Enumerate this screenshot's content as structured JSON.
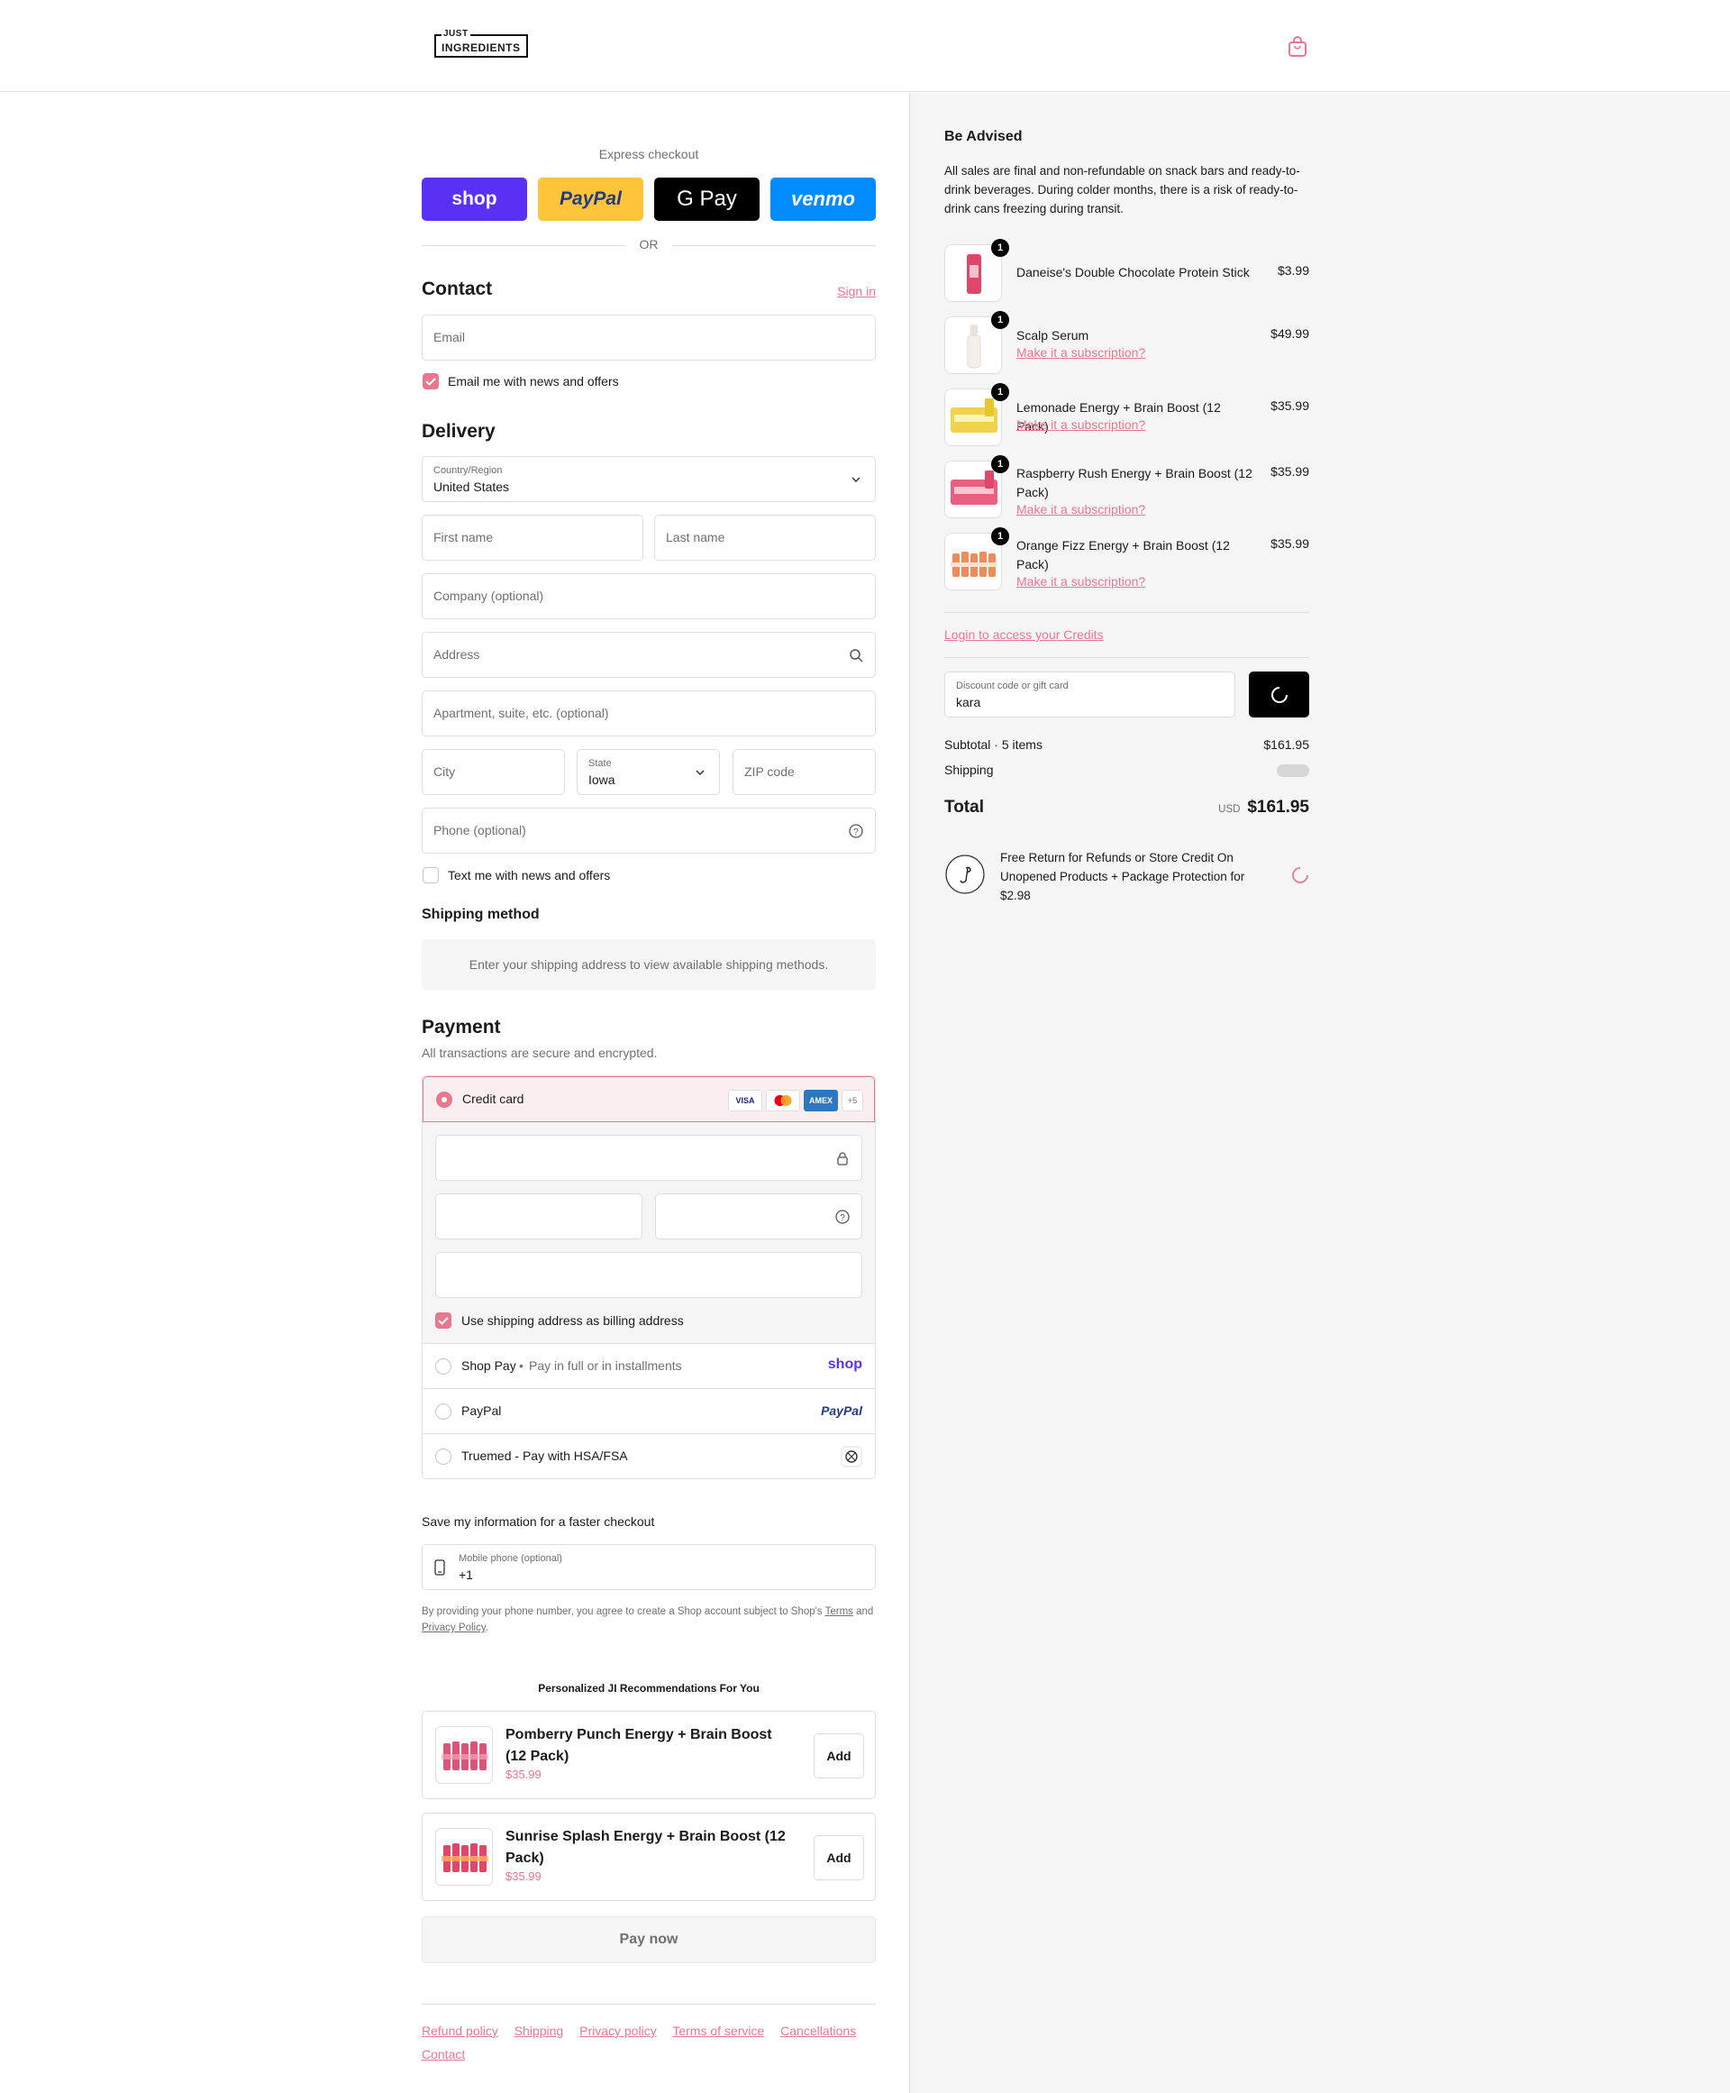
{
  "header": {
    "logo_line1": "JUST",
    "logo_line2": "INGREDIENTS"
  },
  "express": {
    "title": "Express checkout",
    "buttons": [
      "shop",
      "PayPal",
      "G Pay",
      "venmo"
    ],
    "or": "OR"
  },
  "contact": {
    "title": "Contact",
    "sign_in": "Sign in",
    "email_placeholder": "Email",
    "email_opt_in": "Email me with news and offers"
  },
  "delivery": {
    "title": "Delivery",
    "country_label": "Country/Region",
    "country_value": "United States",
    "first_name": "First name",
    "last_name": "Last name",
    "company": "Company (optional)",
    "address": "Address",
    "apartment": "Apartment, suite, etc. (optional)",
    "city": "City",
    "state_label": "State",
    "state_value": "Iowa",
    "zip": "ZIP code",
    "phone": "Phone (optional)",
    "text_opt_in": "Text me with news and offers"
  },
  "shipping": {
    "title": "Shipping method",
    "message": "Enter your shipping address to view available shipping methods."
  },
  "payment": {
    "title": "Payment",
    "subtitle": "All transactions are secure and encrypted.",
    "credit_card": "Credit card",
    "brands": [
      "VISA",
      "MC",
      "AMEX",
      "+5"
    ],
    "billing_same": "Use shipping address as billing address",
    "shop_pay": "Shop Pay",
    "shop_pay_note": "Pay in full or in installments",
    "shop_pay_logo": "shop",
    "paypal": "PayPal",
    "paypal_logo": "PayPal",
    "truemed": "Truemed - Pay with HSA/FSA"
  },
  "save_info": {
    "title": "Save my information for a faster checkout",
    "phone_label": "Mobile phone (optional)",
    "phone_value": "+1",
    "legal_prefix": "By providing your phone number, you agree to create a Shop account subject to Shop's",
    "terms": "Terms",
    "and": "and",
    "privacy": "Privacy Policy",
    "period": "."
  },
  "recommendations": {
    "title": "Personalized JI Recommendations For You",
    "items": [
      {
        "name": "Pomberry Punch Energy + Brain Boost (12 Pack)",
        "price": "$35.99",
        "button": "Add"
      },
      {
        "name": "Sunrise Splash Energy + Brain Boost (12 Pack)",
        "price": "$35.99",
        "button": "Add"
      }
    ]
  },
  "pay_now": "Pay now",
  "footer": [
    "Refund policy",
    "Shipping",
    "Privacy policy",
    "Terms of service",
    "Cancellations",
    "Contact"
  ],
  "sidebar": {
    "advised_title": "Be Advised",
    "advised_text": "All sales are final and non-refundable on snack bars and ready-to-drink beverages. During colder months, there is a risk of ready-to-drink cans freezing during transit.",
    "items": [
      {
        "name": "Daneise's Double Chocolate Protein Stick",
        "price": "$3.99",
        "qty": "1",
        "sub": ""
      },
      {
        "name": "Scalp Serum",
        "price": "$49.99",
        "qty": "1",
        "sub": "Make it a subscription?"
      },
      {
        "name": "Lemonade Energy + Brain Boost (12 Pack)",
        "price": "$35.99",
        "qty": "1",
        "sub": "Make it a subscription?"
      },
      {
        "name": "Raspberry Rush Energy + Brain Boost (12 Pack)",
        "price": "$35.99",
        "qty": "1",
        "sub": "Make it a subscription?"
      },
      {
        "name": "Orange Fizz Energy + Brain Boost (12 Pack)",
        "price": "$35.99",
        "qty": "1",
        "sub": "Make it a subscription?"
      }
    ],
    "credits_link": "Login to access your Credits",
    "discount_label": "Discount code or gift card",
    "discount_value": "kara",
    "subtotal_label": "Subtotal · 5 items",
    "subtotal_value": "$161.95",
    "shipping_label": "Shipping",
    "total_label": "Total",
    "total_currency": "USD",
    "total_value": "$161.95",
    "protection_text": "Free Return for Refunds or Store Credit On Unopened Products + Package Protection for $2.98"
  },
  "colors": {
    "accent": "#e9778f",
    "shop_purple": "#5a31f4",
    "paypal_yellow": "#ffc439",
    "venmo_blue": "#008cff"
  }
}
